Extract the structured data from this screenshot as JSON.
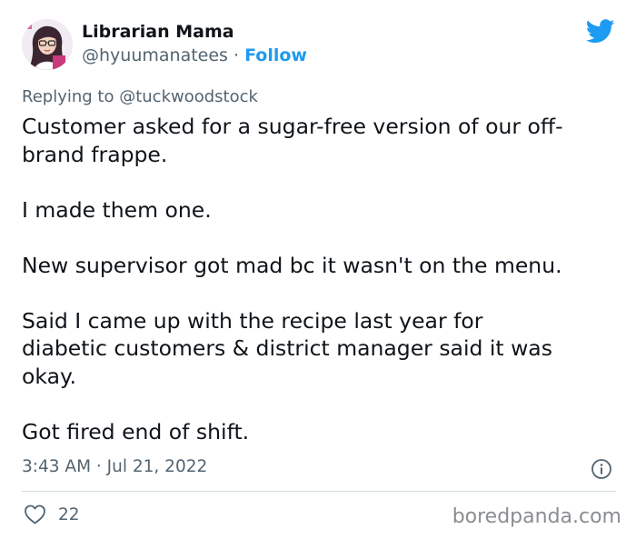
{
  "author": {
    "display_name": "Librarian Mama",
    "handle": "@hyuumanatees",
    "separator": " · ",
    "follow_label": "Follow"
  },
  "reply": {
    "prefix": "Replying to ",
    "mention": "@tuckwoodstock"
  },
  "tweet": {
    "lines": [
      "Customer asked for a sugar-free version of our off-",
      "brand frappe.",
      "I made them one.",
      "New supervisor got mad bc it wasn't on the menu.",
      "Said I came up with the recipe last year for",
      "diabetic customers & district manager said it was",
      "okay.",
      "Got fired end of shift."
    ]
  },
  "meta": {
    "timestamp": "3:43 AM · Jul 21, 2022"
  },
  "engagement": {
    "likes": "22"
  },
  "watermark": "boredpanda.com",
  "colors": {
    "accent": "#1d9bf0",
    "text": "#0f1419",
    "secondary": "#536471",
    "divider": "#cfd9de"
  },
  "icons": [
    "avatar",
    "twitter-bird-icon",
    "info-icon",
    "heart-icon"
  ]
}
